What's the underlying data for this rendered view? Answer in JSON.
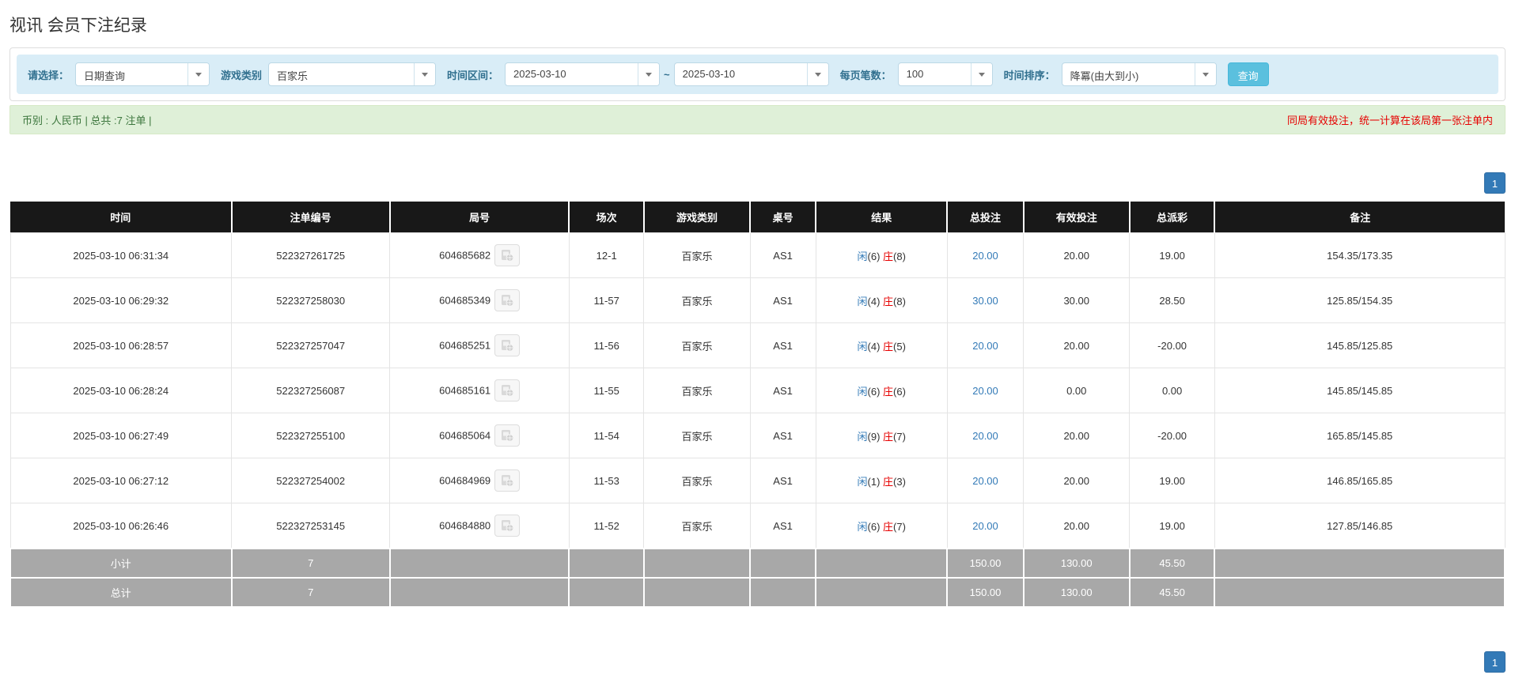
{
  "page": {
    "title": "视讯 会员下注纪录"
  },
  "filters": {
    "select_label": "请选择：",
    "select_value": "日期查询",
    "game_type_label": "游戏类别",
    "game_type_value": "百家乐",
    "time_range_label": "时间区间：",
    "date_from": "2025-03-10",
    "date_separator": "~",
    "date_to": "2025-03-10",
    "page_size_label": "每页笔数：",
    "page_size_value": "100",
    "sort_label": "时间排序：",
    "sort_value": "降冪(由大到小)",
    "search_button": "查询"
  },
  "summary": {
    "left": "币别 : 人民币 | 总共 :7 注单 |",
    "right": "同局有效投注，统一计算在该局第一张注单内"
  },
  "pagination": {
    "page": "1"
  },
  "icons": {
    "dropdown_arrow": "chevron-down",
    "round_video": "video-replay"
  },
  "colors": {
    "toolbar_bg": "#d9edf7",
    "label_blue": "#31708f",
    "search_button_bg": "#5bc0de",
    "alert_bg": "#dff0d8",
    "alert_text_green": "#3c763d",
    "alert_text_red": "#e60000",
    "table_header_bg": "#181818",
    "link_blue": "#337ab7",
    "banker_red": "#e60000",
    "summary_row_bg": "#a8a8a8",
    "pagination_bg": "#337ab7"
  },
  "table": {
    "headers": [
      "时间",
      "注单编号",
      "局号",
      "场次",
      "游戏类别",
      "桌号",
      "结果",
      "总投注",
      "有效投注",
      "总派彩",
      "备注"
    ],
    "col_widths": [
      "14.8%",
      "10.6%",
      "12%",
      "5%",
      "7.1%",
      "4.4%",
      "8.8%",
      "5.1%",
      "7.1%",
      "5.7%",
      "19.4%"
    ],
    "rows": [
      {
        "time": "2025-03-10 06:31:34",
        "bet_id": "522327261725",
        "round_id": "604685682",
        "session": "12-1",
        "game": "百家乐",
        "table_no": "AS1",
        "result": {
          "player_label": "闲",
          "player_score": "(6)",
          "banker_label": "庄",
          "banker_score": "(8)"
        },
        "total_bet": "20.00",
        "valid_bet": "20.00",
        "payout": "19.00",
        "note": "154.35/173.35"
      },
      {
        "time": "2025-03-10 06:29:32",
        "bet_id": "522327258030",
        "round_id": "604685349",
        "session": "11-57",
        "game": "百家乐",
        "table_no": "AS1",
        "result": {
          "player_label": "闲",
          "player_score": "(4)",
          "banker_label": "庄",
          "banker_score": "(8)"
        },
        "total_bet": "30.00",
        "valid_bet": "30.00",
        "payout": "28.50",
        "note": "125.85/154.35"
      },
      {
        "time": "2025-03-10 06:28:57",
        "bet_id": "522327257047",
        "round_id": "604685251",
        "session": "11-56",
        "game": "百家乐",
        "table_no": "AS1",
        "result": {
          "player_label": "闲",
          "player_score": "(4)",
          "banker_label": "庄",
          "banker_score": "(5)"
        },
        "total_bet": "20.00",
        "valid_bet": "20.00",
        "payout": "-20.00",
        "note": "145.85/125.85"
      },
      {
        "time": "2025-03-10 06:28:24",
        "bet_id": "522327256087",
        "round_id": "604685161",
        "session": "11-55",
        "game": "百家乐",
        "table_no": "AS1",
        "result": {
          "player_label": "闲",
          "player_score": "(6)",
          "banker_label": "庄",
          "banker_score": "(6)"
        },
        "total_bet": "20.00",
        "valid_bet": "0.00",
        "payout": "0.00",
        "note": "145.85/145.85"
      },
      {
        "time": "2025-03-10 06:27:49",
        "bet_id": "522327255100",
        "round_id": "604685064",
        "session": "11-54",
        "game": "百家乐",
        "table_no": "AS1",
        "result": {
          "player_label": "闲",
          "player_score": "(9)",
          "banker_label": "庄",
          "banker_score": "(7)"
        },
        "total_bet": "20.00",
        "valid_bet": "20.00",
        "payout": "-20.00",
        "note": "165.85/145.85"
      },
      {
        "time": "2025-03-10 06:27:12",
        "bet_id": "522327254002",
        "round_id": "604684969",
        "session": "11-53",
        "game": "百家乐",
        "table_no": "AS1",
        "result": {
          "player_label": "闲",
          "player_score": "(1)",
          "banker_label": "庄",
          "banker_score": "(3)"
        },
        "total_bet": "20.00",
        "valid_bet": "20.00",
        "payout": "19.00",
        "note": "146.85/165.85"
      },
      {
        "time": "2025-03-10 06:26:46",
        "bet_id": "522327253145",
        "round_id": "604684880",
        "session": "11-52",
        "game": "百家乐",
        "table_no": "AS1",
        "result": {
          "player_label": "闲",
          "player_score": "(6)",
          "banker_label": "庄",
          "banker_score": "(7)"
        },
        "total_bet": "20.00",
        "valid_bet": "20.00",
        "payout": "19.00",
        "note": "127.85/146.85"
      }
    ],
    "subtotal": {
      "label": "小计",
      "count": "7",
      "total_bet": "150.00",
      "valid_bet": "130.00",
      "payout": "45.50"
    },
    "total": {
      "label": "总计",
      "count": "7",
      "total_bet": "150.00",
      "valid_bet": "130.00",
      "payout": "45.50"
    }
  }
}
